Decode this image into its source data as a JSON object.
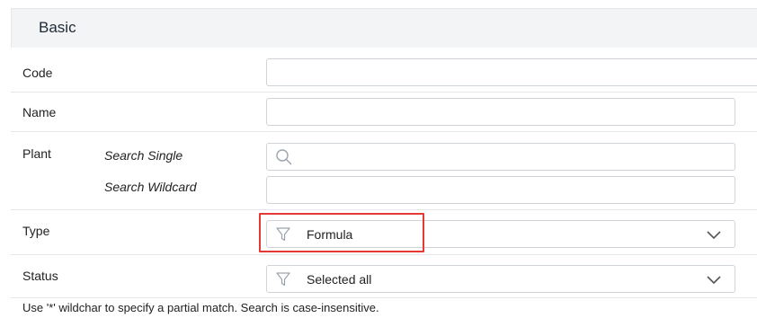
{
  "section": {
    "title": "Basic"
  },
  "fields": {
    "code": {
      "label": "Code",
      "value": ""
    },
    "name": {
      "label": "Name",
      "value": ""
    },
    "plant": {
      "label": "Plant",
      "search_single_label": "Search Single",
      "search_single_value": "",
      "search_wildcard_label": "Search Wildcard",
      "search_wildcard_value": ""
    },
    "type": {
      "label": "Type",
      "selected": "Formula",
      "filter_icon": "funnel-icon"
    },
    "status": {
      "label": "Status",
      "selected": "Selected all",
      "filter_icon": "funnel-icon"
    }
  },
  "footnote": "Use '*' wildchar to specify a partial match. Search is case-insensitive.",
  "colors": {
    "highlight": "#e53935",
    "header_bg": "#f2f4f6",
    "border": "#cfd4da"
  }
}
